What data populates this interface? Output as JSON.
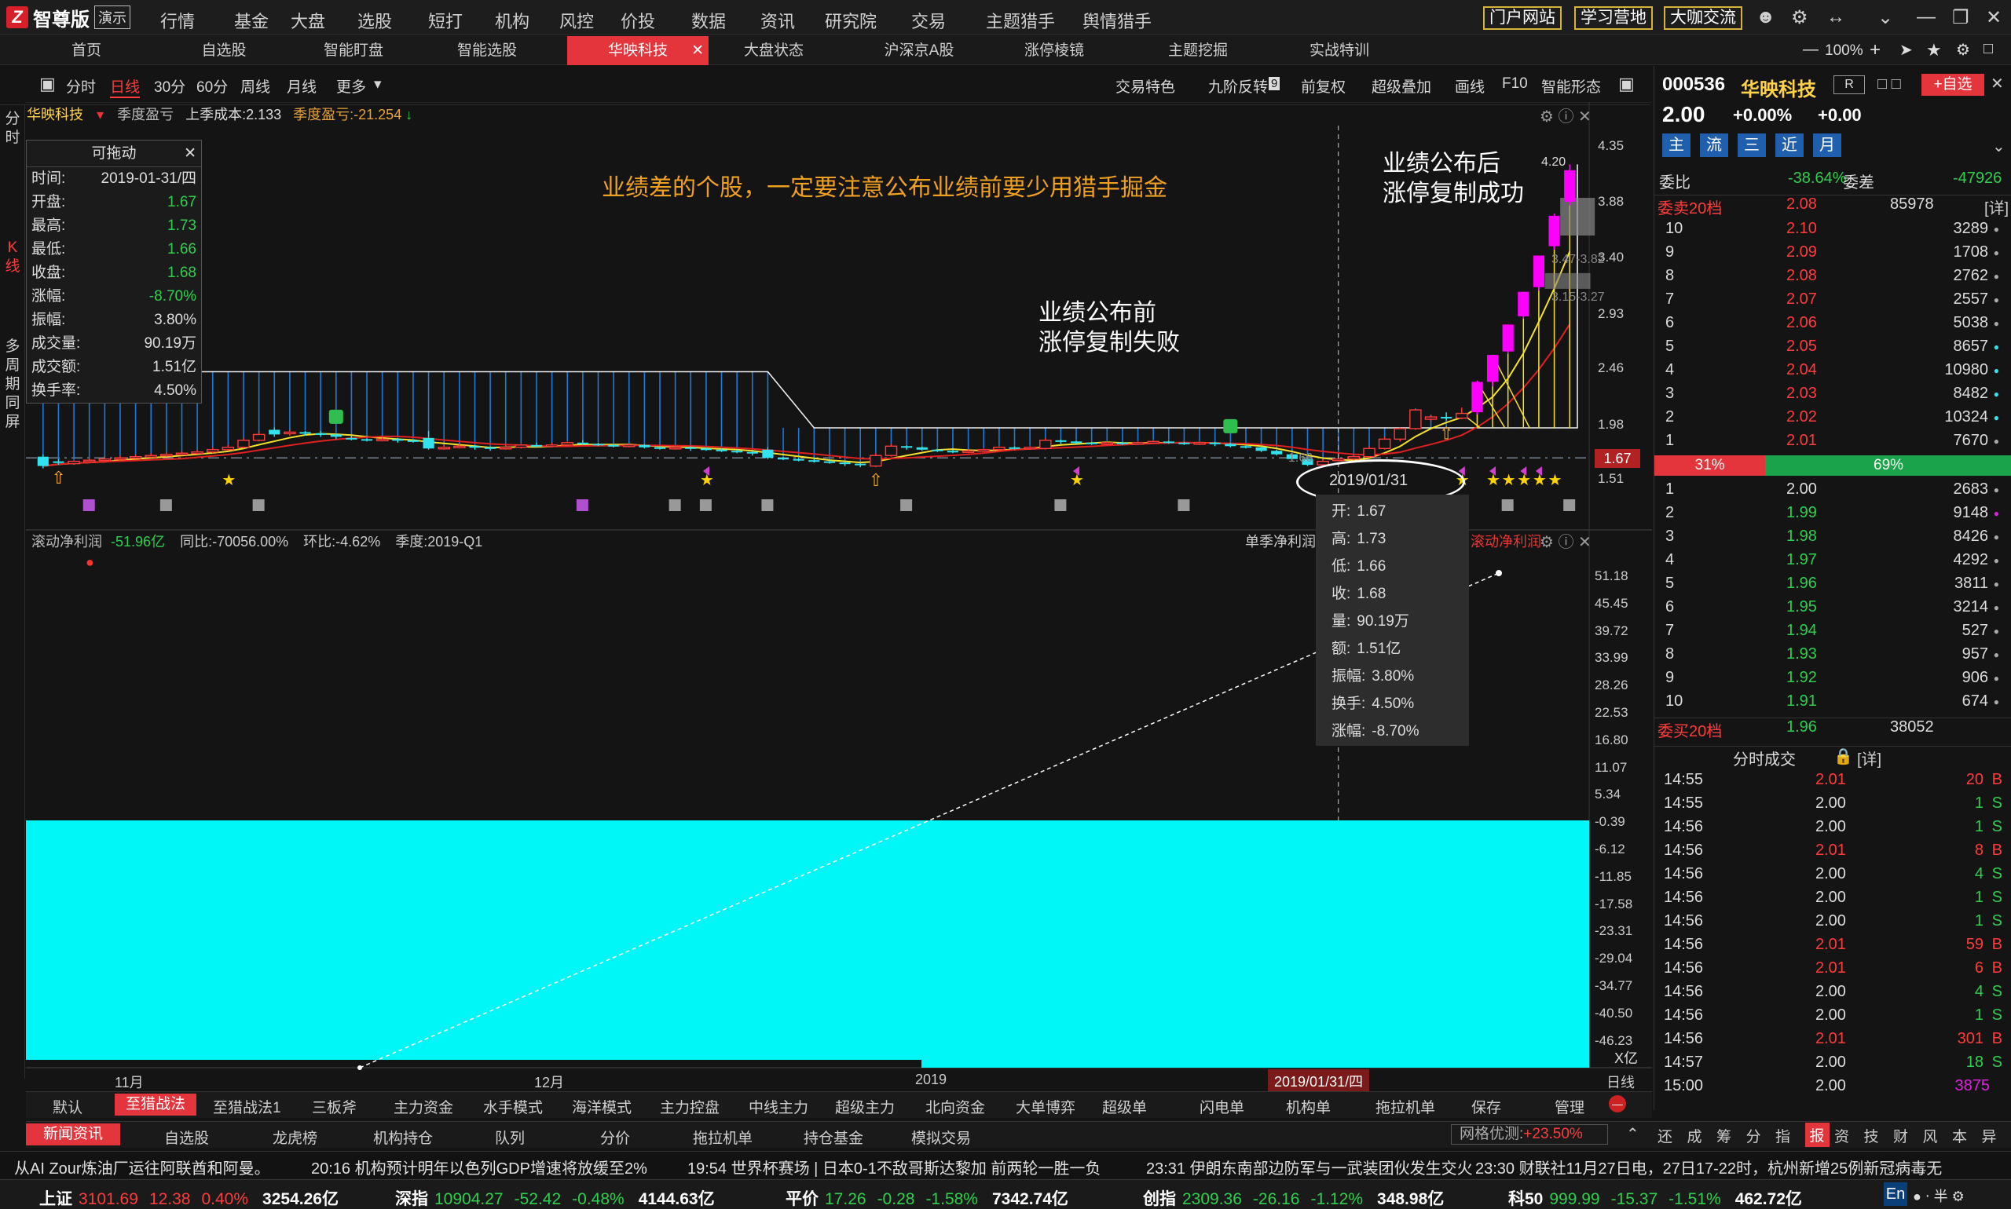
{
  "app": {
    "name": "智尊版",
    "mode": "演示"
  },
  "top_menu": [
    "行情",
    "基金",
    "大盘",
    "选股",
    "短打",
    "机构",
    "风控",
    "价投",
    "数据",
    "资讯",
    "研究院",
    "交易",
    "主题猎手",
    "舆情猎手"
  ],
  "top_links": [
    "门户网站",
    "学习营地",
    "大咖交流"
  ],
  "zoom": "100%",
  "tabs": [
    "首页",
    "自选股",
    "智能盯盘",
    "智能选股",
    "华映科技",
    "大盘状态",
    "沪深京A股",
    "涨停棱镜",
    "主题挖掘",
    "实战特训"
  ],
  "active_tab": "华映科技",
  "chart_toolbar": {
    "periods": [
      "分时",
      "日线",
      "30分",
      "60分",
      "周线",
      "月线",
      "更多"
    ],
    "right": [
      "交易特色",
      "九阶反转",
      "前复权",
      "超级叠加",
      "画线",
      "F10",
      "智能形态"
    ],
    "nine_badge": "9"
  },
  "left_vertical": [
    "分时",
    "K线",
    "多周期同屏"
  ],
  "kline_info": {
    "stock": "华映科技",
    "label1": "季度盈亏",
    "label2": "上季成本:2.133",
    "label3": "季度盈亏:-21.254"
  },
  "hover_panel": {
    "title": "可拖动",
    "rows": [
      {
        "k": "时间:",
        "v": "2019-01-31/四"
      },
      {
        "k": "开盘:",
        "v": "1.67"
      },
      {
        "k": "最高:",
        "v": "1.73"
      },
      {
        "k": "最低:",
        "v": "1.66"
      },
      {
        "k": "收盘:",
        "v": "1.68"
      },
      {
        "k": "涨幅:",
        "v": "-8.70%"
      },
      {
        "k": "振幅:",
        "v": "3.80%"
      },
      {
        "k": "成交量:",
        "v": "90.19万"
      },
      {
        "k": "成交额:",
        "v": "1.51亿"
      },
      {
        "k": "换手率:",
        "v": "4.50%"
      }
    ]
  },
  "annotations": {
    "main_title": "业绩差的个股，一定要注意公布业绩前要少用猎手掘金",
    "before_1": "业绩公布前",
    "before_2": "涨停复制失败",
    "after_1": "业绩公布后",
    "after_2": "涨停复制成功",
    "date_circle": "2019/01/31"
  },
  "price_axis": [
    "4.35",
    "3.88",
    "3.40",
    "2.93",
    "2.46",
    "1.98",
    "1.51"
  ],
  "current_price_tag": "1.67",
  "box_labels": [
    "4.20",
    "3.47-3.82",
    "3.15-3.27",
    "1.66"
  ],
  "tooltip": [
    {
      "k": "开:",
      "v": "1.67"
    },
    {
      "k": "高:",
      "v": "1.73"
    },
    {
      "k": "低:",
      "v": "1.66"
    },
    {
      "k": "收:",
      "v": "1.68"
    },
    {
      "k": "量:",
      "v": "90.19万"
    },
    {
      "k": "额:",
      "v": "1.51亿"
    },
    {
      "k": "振幅:",
      "v": "3.80%"
    },
    {
      "k": "换手:",
      "v": "4.50%"
    },
    {
      "k": "涨幅:",
      "v": "-8.70%"
    }
  ],
  "sub_panel": {
    "title": "滚动净利润",
    "value": "-51.96亿",
    "yoy": "同比:-70056.00%",
    "qoq": "环比:-4.62%",
    "quarter": "季度:2019-Q1",
    "legend1": "单季净利润",
    "legend2": "滚动净利润",
    "axis": [
      "51.18",
      "45.45",
      "39.72",
      "33.99",
      "28.26",
      "22.53",
      "16.80",
      "11.07",
      "5.34",
      "-0.39",
      "-6.12",
      "-11.85",
      "-17.58",
      "-23.31",
      "-29.04",
      "-34.77",
      "-40.50",
      "-46.23"
    ],
    "unit": "X亿"
  },
  "x_axis": {
    "labels": [
      "11月",
      "12月",
      "2019"
    ],
    "cursor": "2019/01/31/四",
    "mode": "日线"
  },
  "quote": {
    "code": "000536",
    "name": "华映科技",
    "tag": "R",
    "add_btn": "+自选",
    "price": "2.00",
    "chg_pct": "+0.00%",
    "chg": "+0.00",
    "buttons": [
      "主",
      "流",
      "三",
      "近",
      "月"
    ],
    "weibi_label": "委比",
    "weibi": "-38.64%",
    "weicha_label": "委差",
    "weicha": "-47926",
    "sell_header": "委卖20档",
    "sell_header_price": "2.08",
    "sell_header_vol": "85978",
    "detail": "[详]",
    "sells": [
      {
        "n": "10",
        "p": "2.10",
        "v": "3289",
        "dot": "#aaaaaa"
      },
      {
        "n": "9",
        "p": "2.09",
        "v": "1708",
        "dot": "#aaaaaa"
      },
      {
        "n": "8",
        "p": "2.08",
        "v": "2762",
        "dot": "#aaaaaa"
      },
      {
        "n": "7",
        "p": "2.07",
        "v": "2557",
        "dot": "#aaaaaa"
      },
      {
        "n": "6",
        "p": "2.06",
        "v": "5038",
        "dot": "#aaaaaa"
      },
      {
        "n": "5",
        "p": "2.05",
        "v": "8657",
        "dot": "#2fe4f0"
      },
      {
        "n": "4",
        "p": "2.04",
        "v": "10980",
        "dot": "#2fe4f0"
      },
      {
        "n": "3",
        "p": "2.03",
        "v": "8482",
        "dot": "#2fe4f0"
      },
      {
        "n": "2",
        "p": "2.02",
        "v": "10324",
        "dot": "#2fe4f0"
      },
      {
        "n": "1",
        "p": "2.01",
        "v": "7670",
        "dot": "#aaaaaa"
      }
    ],
    "bar_left": "31%",
    "bar_right": "69%",
    "buys": [
      {
        "n": "1",
        "p": "2.00",
        "v": "2683",
        "dot": "#aaaaaa"
      },
      {
        "n": "2",
        "p": "1.99",
        "v": "9148",
        "dot": "#e020e0"
      },
      {
        "n": "3",
        "p": "1.98",
        "v": "8426",
        "dot": "#aaaaaa"
      },
      {
        "n": "4",
        "p": "1.97",
        "v": "4292",
        "dot": "#aaaaaa"
      },
      {
        "n": "5",
        "p": "1.96",
        "v": "3811",
        "dot": "#aaaaaa"
      },
      {
        "n": "6",
        "p": "1.95",
        "v": "3214",
        "dot": "#aaaaaa"
      },
      {
        "n": "7",
        "p": "1.94",
        "v": "527",
        "dot": "#aaaaaa"
      },
      {
        "n": "8",
        "p": "1.93",
        "v": "957",
        "dot": "#aaaaaa"
      },
      {
        "n": "9",
        "p": "1.92",
        "v": "906",
        "dot": "#aaaaaa"
      },
      {
        "n": "10",
        "p": "1.91",
        "v": "674",
        "dot": "#aaaaaa"
      }
    ],
    "buy_header": "委买20档",
    "buy_header_price": "1.96",
    "buy_header_vol": "38052",
    "ticks_header": "分时成交",
    "ticks": [
      {
        "t": "14:55",
        "p": "2.01",
        "v": "20",
        "s": "B"
      },
      {
        "t": "14:55",
        "p": "2.00",
        "v": "1",
        "s": "S"
      },
      {
        "t": "14:56",
        "p": "2.00",
        "v": "1",
        "s": "S"
      },
      {
        "t": "14:56",
        "p": "2.01",
        "v": "8",
        "s": "B"
      },
      {
        "t": "14:56",
        "p": "2.00",
        "v": "4",
        "s": "S"
      },
      {
        "t": "14:56",
        "p": "2.00",
        "v": "1",
        "s": "S"
      },
      {
        "t": "14:56",
        "p": "2.00",
        "v": "1",
        "s": "S"
      },
      {
        "t": "14:56",
        "p": "2.01",
        "v": "59",
        "s": "B"
      },
      {
        "t": "14:56",
        "p": "2.01",
        "v": "6",
        "s": "B"
      },
      {
        "t": "14:56",
        "p": "2.00",
        "v": "4",
        "s": "S"
      },
      {
        "t": "14:56",
        "p": "2.00",
        "v": "1",
        "s": "S"
      },
      {
        "t": "14:56",
        "p": "2.01",
        "v": "301",
        "s": "B"
      },
      {
        "t": "14:57",
        "p": "2.00",
        "v": "18",
        "s": "S"
      },
      {
        "t": "15:00",
        "p": "2.00",
        "v": "3875",
        "s": ""
      }
    ]
  },
  "strategy_tabs": [
    "默认",
    "至猎战法",
    "至猎战法1",
    "三板斧",
    "主力资金",
    "水手模式",
    "海洋模式",
    "主力控盘",
    "中线主力",
    "超级主力",
    "北向资金",
    "大单博弈",
    "超级单",
    "闪电单",
    "机构单",
    "拖拉机单",
    "保存",
    "管理"
  ],
  "news_tabs": [
    "新闻资讯",
    "自选股",
    "龙虎榜",
    "机构持仓",
    "队列",
    "分价",
    "拖拉机单",
    "持仓基金",
    "模拟交易"
  ],
  "grid_label": "网格优测:",
  "grid_value": "+23.50%",
  "right_icons": [
    "还",
    "成",
    "筹",
    "分",
    "指",
    "报",
    "资",
    "技",
    "财",
    "风",
    "本",
    "异"
  ],
  "ticker": [
    "从AI Zour炼油厂运往阿联酋和阿曼。",
    "20:16 机构预计明年以色列GDP增速将放缓至2%",
    "19:54 世界杯赛场 | 日本0-1不敌哥斯达黎加 前两轮一胜一负",
    "23:31 伊朗东南部边防军与一武装团伙发生交火",
    "23:30 财联社11月27日电，27日17-22时，杭州新增25例新冠病毒无"
  ],
  "indexes": [
    {
      "name": "上证",
      "v": "3101.69",
      "c": "12.38",
      "p": "0.40%",
      "a": "3254.26亿",
      "up": true
    },
    {
      "name": "深指",
      "v": "10904.27",
      "c": "-52.42",
      "p": "-0.48%",
      "a": "4144.63亿",
      "up": false
    },
    {
      "name": "平价",
      "v": "17.26",
      "c": "-0.28",
      "p": "-1.58%",
      "a": "7342.74亿",
      "up": false
    },
    {
      "name": "创指",
      "v": "2309.36",
      "c": "-26.16",
      "p": "-1.12%",
      "a": "348.98亿",
      "up": false
    },
    {
      "name": "科50",
      "v": "999.99",
      "c": "-15.37",
      "p": "-1.51%",
      "a": "462.72亿",
      "up": false
    }
  ],
  "chart_data": {
    "type": "candlestick",
    "title": "华映科技",
    "period": "日线",
    "x_labels": [
      "11月",
      "12月",
      "2019"
    ],
    "ylim": [
      1.51,
      4.35
    ],
    "highlight_date": "2019-01-31",
    "ohlc": [
      [
        1.7,
        1.62,
        1.72,
        1.6
      ],
      [
        1.66,
        1.65,
        1.68,
        1.63
      ],
      [
        1.64,
        1.66,
        1.67,
        1.63
      ],
      [
        1.66,
        1.67,
        1.69,
        1.65
      ],
      [
        1.67,
        1.68,
        1.7,
        1.66
      ],
      [
        1.68,
        1.69,
        1.71,
        1.67
      ],
      [
        1.69,
        1.7,
        1.72,
        1.68
      ],
      [
        1.7,
        1.71,
        1.73,
        1.69
      ],
      [
        1.71,
        1.72,
        1.74,
        1.7
      ],
      [
        1.72,
        1.73,
        1.75,
        1.71
      ],
      [
        1.73,
        1.74,
        1.76,
        1.72
      ],
      [
        1.74,
        1.76,
        1.78,
        1.73
      ],
      [
        1.76,
        1.78,
        1.8,
        1.75
      ],
      [
        1.78,
        1.84,
        1.86,
        1.77
      ],
      [
        1.84,
        1.89,
        1.92,
        1.83
      ],
      [
        1.93,
        1.89,
        1.95,
        1.87
      ],
      [
        1.9,
        1.91,
        1.93,
        1.88
      ],
      [
        1.91,
        1.9,
        1.92,
        1.88
      ],
      [
        1.9,
        1.89,
        1.92,
        1.87
      ],
      [
        1.89,
        1.87,
        1.9,
        1.85
      ],
      [
        1.86,
        1.85,
        1.88,
        1.84
      ],
      [
        1.85,
        1.84,
        1.86,
        1.83
      ],
      [
        1.84,
        1.85,
        1.87,
        1.83
      ],
      [
        1.85,
        1.84,
        1.86,
        1.82
      ],
      [
        1.84,
        1.83,
        1.85,
        1.82
      ],
      [
        1.86,
        1.77,
        1.92,
        1.76
      ],
      [
        1.77,
        1.78,
        1.8,
        1.76
      ],
      [
        1.78,
        1.79,
        1.81,
        1.77
      ],
      [
        1.79,
        1.78,
        1.8,
        1.76
      ],
      [
        1.78,
        1.77,
        1.79,
        1.75
      ],
      [
        1.77,
        1.78,
        1.8,
        1.76
      ],
      [
        1.78,
        1.8,
        1.81,
        1.77
      ],
      [
        1.8,
        1.79,
        1.82,
        1.78
      ],
      [
        1.79,
        1.8,
        1.82,
        1.78
      ],
      [
        1.8,
        1.82,
        1.83,
        1.79
      ],
      [
        1.82,
        1.81,
        1.84,
        1.8
      ],
      [
        1.81,
        1.8,
        1.82,
        1.79
      ],
      [
        1.8,
        1.79,
        1.81,
        1.78
      ],
      [
        1.79,
        1.8,
        1.81,
        1.78
      ],
      [
        1.8,
        1.78,
        1.81,
        1.77
      ],
      [
        1.78,
        1.77,
        1.79,
        1.76
      ],
      [
        1.77,
        1.78,
        1.79,
        1.76
      ],
      [
        1.78,
        1.77,
        1.79,
        1.75
      ],
      [
        1.77,
        1.76,
        1.78,
        1.75
      ],
      [
        1.76,
        1.75,
        1.77,
        1.74
      ],
      [
        1.75,
        1.74,
        1.76,
        1.73
      ],
      [
        1.74,
        1.73,
        1.75,
        1.71
      ],
      [
        1.76,
        1.69,
        1.78,
        1.68
      ],
      [
        1.69,
        1.68,
        1.7,
        1.67
      ],
      [
        1.68,
        1.67,
        1.69,
        1.66
      ],
      [
        1.67,
        1.66,
        1.68,
        1.65
      ],
      [
        1.66,
        1.65,
        1.67,
        1.64
      ],
      [
        1.65,
        1.64,
        1.66,
        1.62
      ],
      [
        1.64,
        1.63,
        1.65,
        1.61
      ],
      [
        1.62,
        1.71,
        1.73,
        1.61
      ],
      [
        1.71,
        1.79,
        1.81,
        1.7
      ],
      [
        1.79,
        1.78,
        1.8,
        1.76
      ],
      [
        1.78,
        1.76,
        1.79,
        1.75
      ],
      [
        1.76,
        1.75,
        1.77,
        1.74
      ],
      [
        1.75,
        1.74,
        1.76,
        1.73
      ],
      [
        1.74,
        1.75,
        1.76,
        1.73
      ],
      [
        1.75,
        1.76,
        1.77,
        1.74
      ],
      [
        1.76,
        1.78,
        1.79,
        1.75
      ],
      [
        1.78,
        1.77,
        1.79,
        1.76
      ],
      [
        1.77,
        1.78,
        1.79,
        1.76
      ],
      [
        1.77,
        1.84,
        1.86,
        1.76
      ],
      [
        1.84,
        1.83,
        1.85,
        1.81
      ],
      [
        1.83,
        1.82,
        1.84,
        1.81
      ],
      [
        1.82,
        1.81,
        1.83,
        1.8
      ],
      [
        1.81,
        1.82,
        1.83,
        1.8
      ],
      [
        1.82,
        1.81,
        1.83,
        1.8
      ],
      [
        1.81,
        1.82,
        1.83,
        1.8
      ],
      [
        1.82,
        1.83,
        1.84,
        1.81
      ],
      [
        1.83,
        1.82,
        1.84,
        1.81
      ],
      [
        1.82,
        1.81,
        1.83,
        1.8
      ],
      [
        1.81,
        1.82,
        1.83,
        1.8
      ],
      [
        1.82,
        1.81,
        1.83,
        1.79
      ],
      [
        1.81,
        1.79,
        1.82,
        1.78
      ],
      [
        1.79,
        1.78,
        1.8,
        1.77
      ],
      [
        1.78,
        1.75,
        1.79,
        1.74
      ],
      [
        1.75,
        1.72,
        1.76,
        1.71
      ],
      [
        1.72,
        1.68,
        1.73,
        1.66
      ],
      [
        1.68,
        1.63,
        1.69,
        1.62
      ],
      [
        1.63,
        1.66,
        1.68,
        1.62
      ],
      [
        1.67,
        1.68,
        1.73,
        1.66
      ],
      [
        1.68,
        1.7,
        1.72,
        1.67
      ],
      [
        1.7,
        1.77,
        1.79,
        1.69
      ],
      [
        1.77,
        1.85,
        1.87,
        1.76
      ],
      [
        1.85,
        1.94,
        1.95,
        1.83
      ],
      [
        1.94,
        2.1,
        2.1,
        1.93
      ],
      [
        2.02,
        2.04,
        2.06,
        2.0
      ],
      [
        2.04,
        2.03,
        2.08,
        2.01
      ],
      [
        2.03,
        2.07,
        2.12,
        2.02
      ],
      [
        2.08,
        2.34,
        2.35,
        2.06
      ],
      [
        2.34,
        2.57,
        2.57,
        2.3
      ],
      [
        2.6,
        2.83,
        2.83,
        2.58
      ],
      [
        2.9,
        3.11,
        3.11,
        2.88
      ],
      [
        3.15,
        3.42,
        3.42,
        3.12
      ],
      [
        3.5,
        3.76,
        3.78,
        3.47
      ],
      [
        3.88,
        4.15,
        4.2,
        3.85
      ]
    ]
  },
  "colors": {
    "up": "#ff3b3b",
    "down": "#2fe4f0",
    "limit_up": "#ff00ff",
    "ma1": "#f5e12a",
    "ma2": "#e02020",
    "accent": "#e5353c"
  }
}
